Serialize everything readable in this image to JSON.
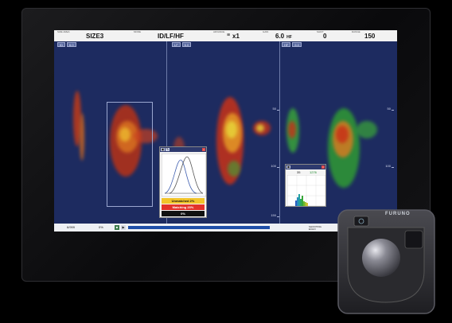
{
  "status": {
    "size_area": {
      "label": "SIZE AREA",
      "value": "SIZE3"
    },
    "mode": {
      "label": "MODE",
      "value": "ID/LF/HF"
    },
    "advance": {
      "label": "ADVANCE",
      "value": "x1"
    },
    "gain": {
      "label": "GAIN",
      "value": "6.0",
      "unit": "HF"
    },
    "shift": {
      "label": "SHIFT",
      "value": "0"
    },
    "range": {
      "label": "RANGE",
      "value": "150"
    }
  },
  "panels": [
    {
      "tags": [
        "ID",
        "6.0"
      ]
    },
    {
      "tags": [
        "LF",
        "6.0"
      ]
    },
    {
      "tags": [
        "HF",
        "6.0"
      ]
    }
  ],
  "depth_ticks_a": [
    "50",
    "100",
    "150"
  ],
  "depth_ticks_b": [
    "50",
    "100",
    "150"
  ],
  "popup_left": {
    "rows": [
      {
        "text": "Unmatched  2%",
        "color": "#f2c42a"
      },
      {
        "text": "Matching  23%",
        "color": "#e3322a"
      },
      {
        "text": "0%",
        "color": "#111111"
      }
    ]
  },
  "popup_right": {
    "values": [
      "35",
      "1276"
    ]
  },
  "bottom": {
    "counter": "6/999",
    "percent": "0%",
    "info": [
      "SHOOTING",
      "ECHO"
    ]
  },
  "controller": {
    "brand": "FURUNO"
  },
  "colors": {
    "screen_bg": "#1b2a5c",
    "echo_red": "#c8301c",
    "echo_orange": "#e07a20",
    "echo_yellow": "#e8d030",
    "echo_green": "#3aa838"
  }
}
